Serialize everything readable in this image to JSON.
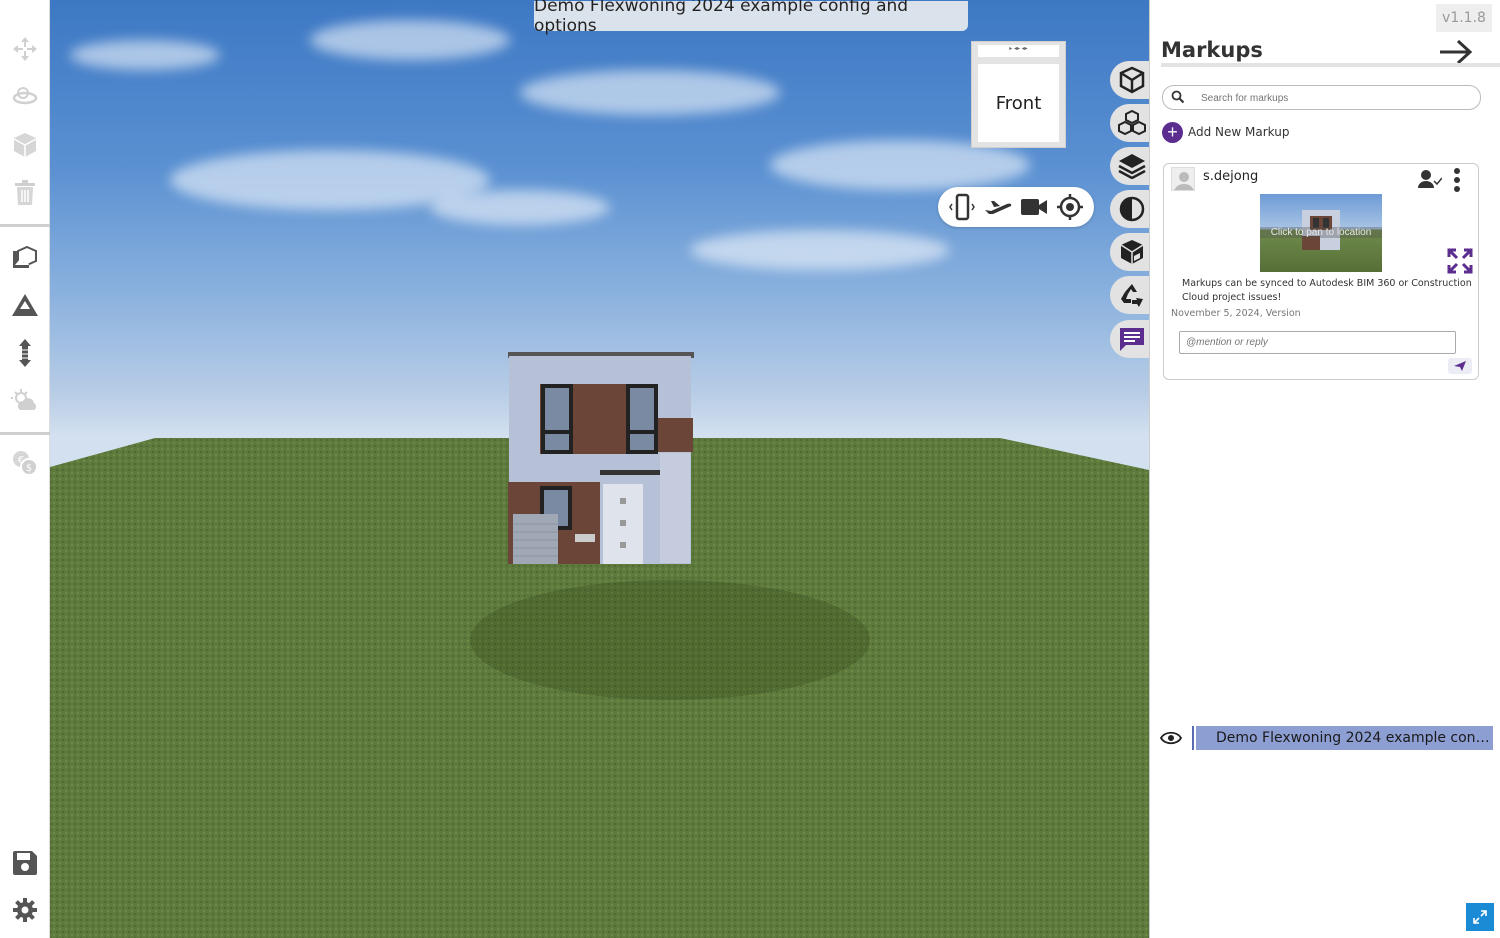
{
  "viewport": {
    "title": "Demo Flexwoning 2024 example config and options",
    "view_cube": {
      "face_label": "Front",
      "top_label": "▸ ◂▸ ◂▸"
    }
  },
  "left_toolbar": {
    "items": [
      {
        "name": "move",
        "icon": "move-icon",
        "enabled": false
      },
      {
        "name": "orbit",
        "icon": "orbit-icon",
        "enabled": false
      },
      {
        "name": "object",
        "icon": "cube-icon",
        "enabled": false
      },
      {
        "name": "delete",
        "icon": "trash-icon",
        "enabled": false
      },
      {
        "name": "models",
        "icon": "model-gallery-icon",
        "enabled": true
      },
      {
        "name": "terrain",
        "icon": "terrain-icon",
        "enabled": true
      },
      {
        "name": "height",
        "icon": "vertical-arrows-icon",
        "enabled": true
      },
      {
        "name": "weather",
        "icon": "weather-icon",
        "enabled": false
      },
      {
        "name": "costs",
        "icon": "cost-icon",
        "enabled": false
      },
      {
        "name": "save",
        "icon": "save-icon",
        "enabled": true
      },
      {
        "name": "settings",
        "icon": "gear-icon",
        "enabled": true
      }
    ]
  },
  "navigation": {
    "items": [
      "phone-rotate-icon",
      "fly-icon",
      "camera-icon",
      "locate-icon"
    ]
  },
  "right_tools": {
    "items": [
      "cube-icon",
      "cubes-icon",
      "layers-icon",
      "contrast-icon",
      "section-cube-icon",
      "recycle-icon",
      "comment-icon"
    ]
  },
  "markups": {
    "version": "v1.1.8",
    "title": "Markups",
    "search_placeholder": "Search for markups",
    "add_label": "Add New Markup",
    "card": {
      "user": "s.dejong",
      "thumbnail_caption": "Click to pan to location",
      "message": "Markups can be synced to Autodesk BIM 360 or Construction Cloud project issues!",
      "date": "November 5, 2024, Version",
      "reply_placeholder": "@mention or reply"
    },
    "model_name": "Demo Flexwoning 2024 example config and options"
  },
  "colors": {
    "accent": "#5b2d8e",
    "model_row": "#8d9ed3",
    "corner_button": "#1c8bd6"
  }
}
